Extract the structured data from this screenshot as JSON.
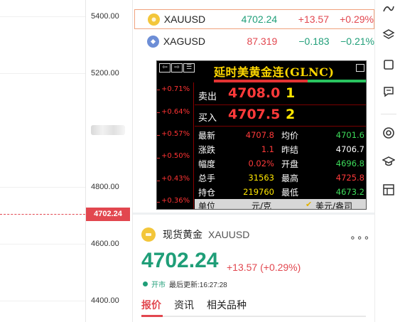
{
  "chart": {
    "axis_ticks": [
      "5400.00",
      "5200.00",
      "4800.00",
      "4600.00",
      "4400.00"
    ],
    "current_price_tag": "4702.24"
  },
  "watchlist": [
    {
      "symbol": "XAUUSD",
      "last": "4702.24",
      "change": "+13.57",
      "percent": "+0.29%",
      "last_color": "#1f9e78",
      "change_color": "#e2474f",
      "icon": "gold-coin-icon"
    },
    {
      "symbol": "XAGUSD",
      "last": "87.319",
      "change": "−0.183",
      "percent": "−0.21%",
      "last_color": "#e2474f",
      "change_color": "#1f9e78",
      "icon": "silver-coin-icon"
    }
  ],
  "popup": {
    "title": "延时美黄金连(GLNC)",
    "side_percents": [
      "+0.71%",
      "+0.64%",
      "+0.57%",
      "+0.50%",
      "+0.43%",
      "+0.36%"
    ],
    "sell": {
      "label": "卖出",
      "price": "4708.0",
      "qty": "1"
    },
    "buy": {
      "label": "买入",
      "price": "4707.5",
      "qty": "2"
    },
    "rows": [
      {
        "l1": "最新",
        "v1": "4707.8",
        "c1": "#ff3a3a",
        "l2": "均价",
        "v2": "4701.6",
        "c2": "#3ddc5a"
      },
      {
        "l1": "涨跌",
        "v1": "1.1",
        "c1": "#ff3a3a",
        "l2": "昨结",
        "v2": "4706.7",
        "c2": "#ffffff"
      },
      {
        "l1": "幅度",
        "v1": "0.02%",
        "c1": "#ff3a3a",
        "l2": "开盘",
        "v2": "4696.8",
        "c2": "#3ddc5a"
      },
      {
        "l1": "总手",
        "v1": "31563",
        "c1": "#ffe600",
        "l2": "最高",
        "v2": "4725.8",
        "c2": "#ff3a3a"
      },
      {
        "l1": "持仓",
        "v1": "219760",
        "c1": "#ffe600",
        "l2": "最低",
        "v2": "4673.2",
        "c2": "#3ddc5a"
      }
    ],
    "unit_label": "单位",
    "unit_value": "元/克",
    "unit_alt": "美元/盎司"
  },
  "card": {
    "name": "现货黄金",
    "code": "XAUUSD",
    "price": "4702.24",
    "change": "+13.57 (+0.29%)",
    "market_status": "开市",
    "last_update": "最后更新:16:27:28",
    "more": "∘∘∘",
    "tabs": [
      "报价",
      "资讯",
      "相关品种"
    ]
  },
  "colors": {
    "up": "#e2474f",
    "down": "#1f9e78",
    "accent": "#e2474f"
  }
}
